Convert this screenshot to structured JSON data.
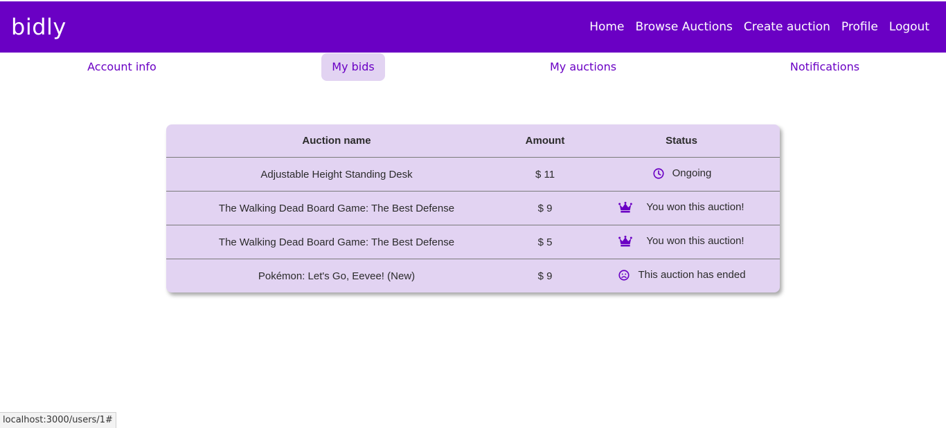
{
  "app": {
    "brand": "bidly"
  },
  "nav": {
    "items": [
      "Home",
      "Browse Auctions",
      "Create auction",
      "Profile",
      "Logout"
    ]
  },
  "tabs": [
    "Account info",
    "My bids",
    "My auctions",
    "Notifications"
  ],
  "table": {
    "headers": [
      "Auction name",
      "Amount",
      "Status"
    ],
    "rows": [
      {
        "name": "Adjustable Height Standing Desk",
        "amount": "$ 11",
        "status": "Ongoing",
        "icon": "clock-icon"
      },
      {
        "name": "The Walking Dead Board Game: The Best Defense",
        "amount": "$ 9",
        "status": "You won this auction!",
        "icon": "crown-icon"
      },
      {
        "name": "The Walking Dead Board Game: The Best Defense",
        "amount": "$ 5",
        "status": "You won this auction!",
        "icon": "crown-icon"
      },
      {
        "name": "Pokémon: Let's Go, Eevee! (New)",
        "amount": "$ 9",
        "status": "This auction has ended",
        "icon": "sad-face-icon"
      }
    ]
  },
  "status_bar": {
    "url": "localhost:3000/users/1#"
  },
  "colors": {
    "primary": "#6a00c4",
    "tab_active_bg": "#e2d3f2",
    "card_bg": "#e2d3f2"
  }
}
